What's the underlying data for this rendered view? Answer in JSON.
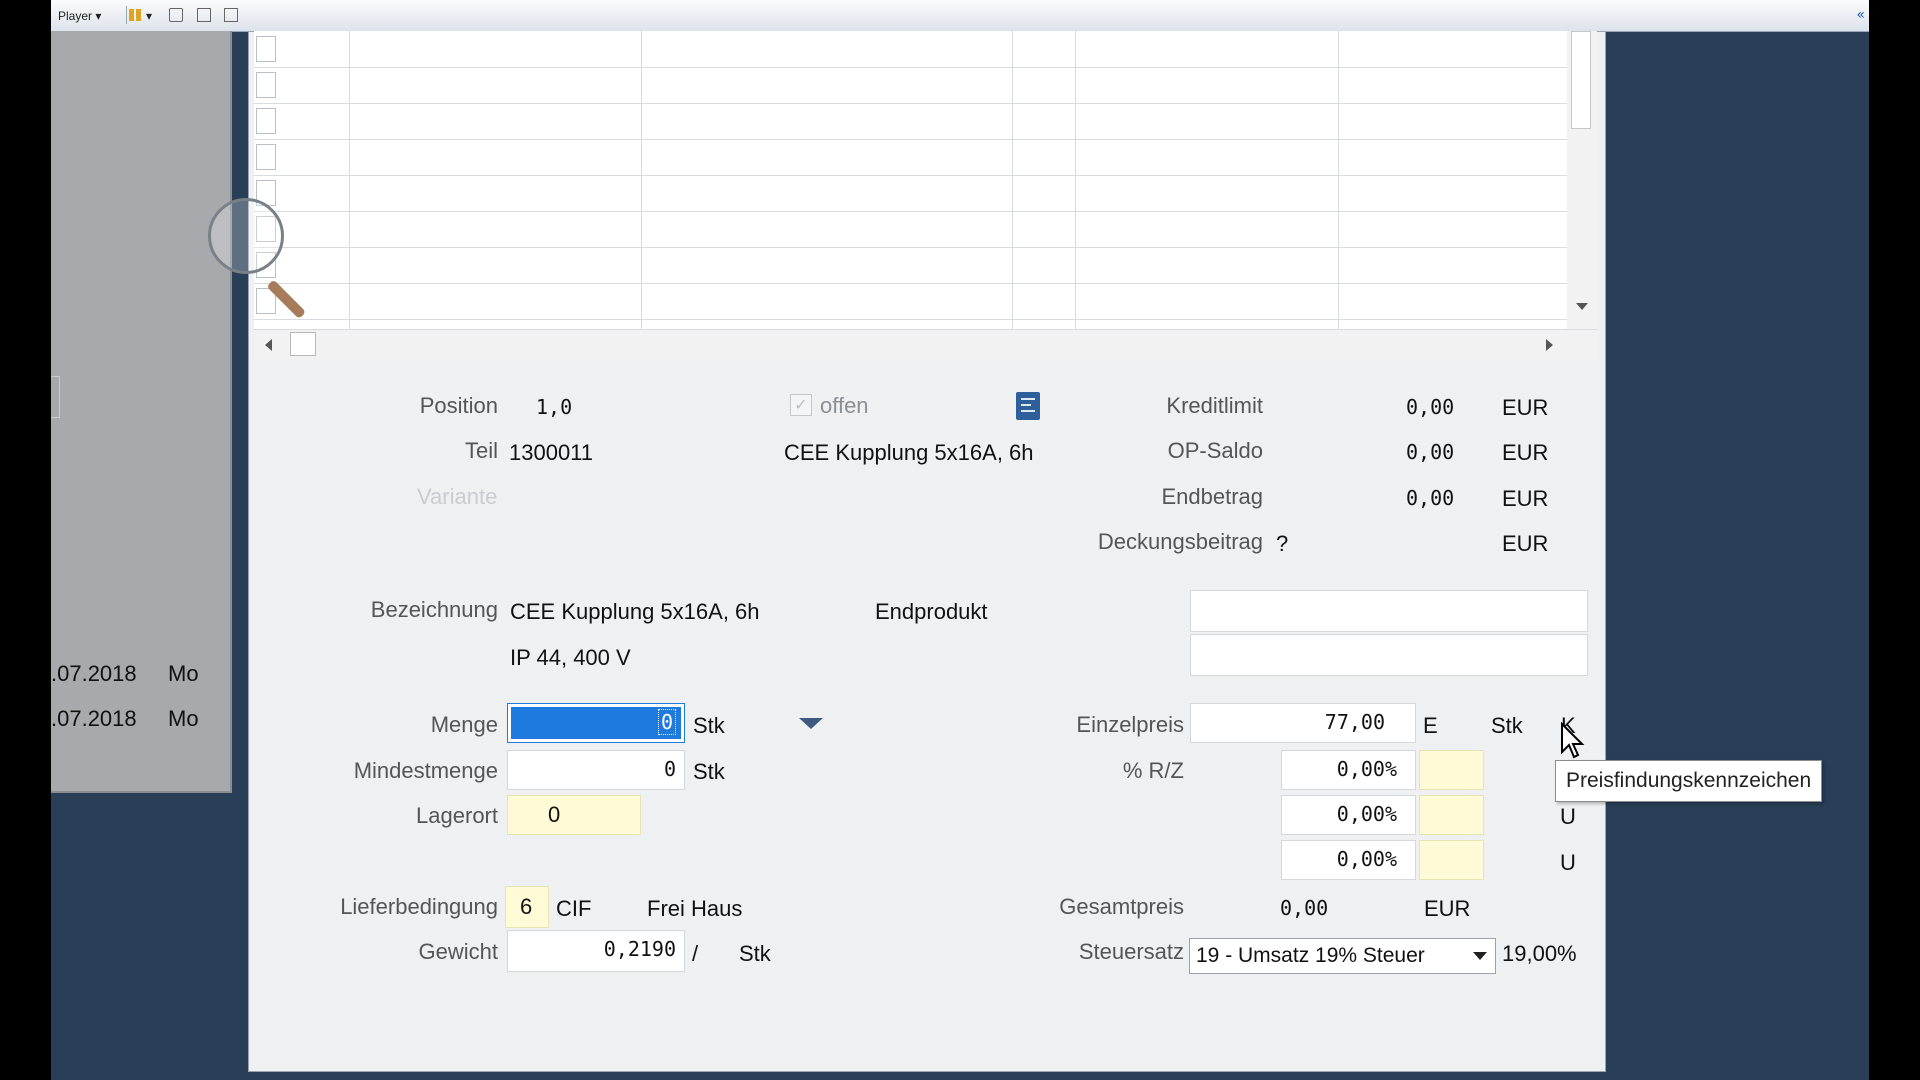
{
  "toolbar": {
    "player_label": "Player",
    "player_dropdown": "▾"
  },
  "left_panel": {
    "rows": [
      {
        "date": ".07.2018",
        "day": "Mo"
      },
      {
        "date": ".07.2018",
        "day": "Mo"
      }
    ]
  },
  "form": {
    "position_label": "Position",
    "position_value": "1,0",
    "offen_label": "offen",
    "teil_label": "Teil",
    "teil_value": "1300011",
    "teil_description": "CEE Kupplung 5x16A, 6h",
    "variante_label": "Variante",
    "kreditlimit_label": "Kreditlimit",
    "kreditlimit_value": "0,00",
    "kreditlimit_currency": "EUR",
    "opsaldo_label": "OP-Saldo",
    "opsaldo_value": "0,00",
    "opsaldo_currency": "EUR",
    "endbetrag_label": "Endbetrag",
    "endbetrag_value": "0,00",
    "endbetrag_currency": "EUR",
    "deckungsbeitrag_label": "Deckungsbeitrag",
    "deckungsbeitrag_value": "?",
    "deckungsbeitrag_currency": "EUR",
    "bezeichnung_label": "Bezeichnung",
    "bezeichnung_line1": "CEE Kupplung 5x16A, 6h",
    "bezeichnung_line2": "IP 44, 400 V",
    "endprodukt_label": "Endprodukt",
    "menge_label": "Menge",
    "menge_value": "0",
    "menge_unit": "Stk",
    "mindestmenge_label": "Mindestmenge",
    "mindestmenge_value": "0",
    "mindestmenge_unit": "Stk",
    "lagerort_label": "Lagerort",
    "lagerort_value": "0",
    "lieferbedingung_label": "Lieferbedingung",
    "lieferbedingung_code": "6",
    "lieferbedingung_incoterm": "CIF",
    "lieferbedingung_text": "Frei Haus",
    "gewicht_label": "Gewicht",
    "gewicht_value": "0,2190",
    "gewicht_sep": "/",
    "gewicht_unit": "Stk",
    "einzelpreis_label": "Einzelpreis",
    "einzelpreis_value": "77,00",
    "einzelpreis_flag": "E",
    "einzelpreis_unit": "Stk",
    "einzelpreis_k": "K",
    "rz_label": "% R/Z",
    "rz_values": [
      "0,00%",
      "0,00%",
      "0,00%"
    ],
    "rz_flags": [
      "U",
      "U"
    ],
    "gesamtpreis_label": "Gesamtpreis",
    "gesamtpreis_value": "0,00",
    "gesamtpreis_currency": "EUR",
    "steuersatz_label": "Steuersatz",
    "steuersatz_selected": "19 - Umsatz 19% Steuer",
    "steuersatz_percent": "19,00%"
  },
  "tooltip": {
    "text": "Preisfindungskennzeichen"
  },
  "colors": {
    "selection": "#1f7ae0",
    "frame": "#283f57",
    "yellow_field": "#fffbd6"
  }
}
